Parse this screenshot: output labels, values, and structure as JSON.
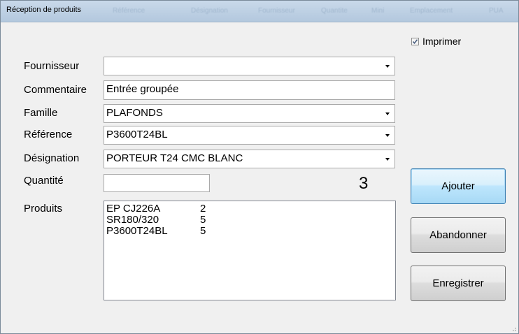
{
  "window": {
    "title": "Réception de produits"
  },
  "ghost_headers": [
    "Référence",
    "Désignation",
    "Fournisseur",
    "Quantite",
    "Mini",
    "Emplacement",
    "PUA"
  ],
  "print_checkbox": {
    "label": "Imprimer",
    "checked": true
  },
  "form": {
    "supplier_label": "Fournisseur",
    "supplier_value": "",
    "comment_label": "Commentaire",
    "comment_value": "Entrée groupée",
    "family_label": "Famille",
    "family_value": "PLAFONDS",
    "reference_label": "Référence",
    "reference_value": "P3600T24BL",
    "designation_label": "Désignation",
    "designation_value": "PORTEUR T24 CMC BLANC",
    "quantity_label": "Quantité",
    "quantity_value": "",
    "stock_count": "3",
    "products_label": "Produits"
  },
  "products": [
    {
      "ref": "EP CJ226A",
      "qty": "2"
    },
    {
      "ref": "SR180/320",
      "qty": "5"
    },
    {
      "ref": "P3600T24BL",
      "qty": "5"
    }
  ],
  "buttons": {
    "add": "Ajouter",
    "abandon": "Abandonner",
    "save": "Enregistrer"
  }
}
